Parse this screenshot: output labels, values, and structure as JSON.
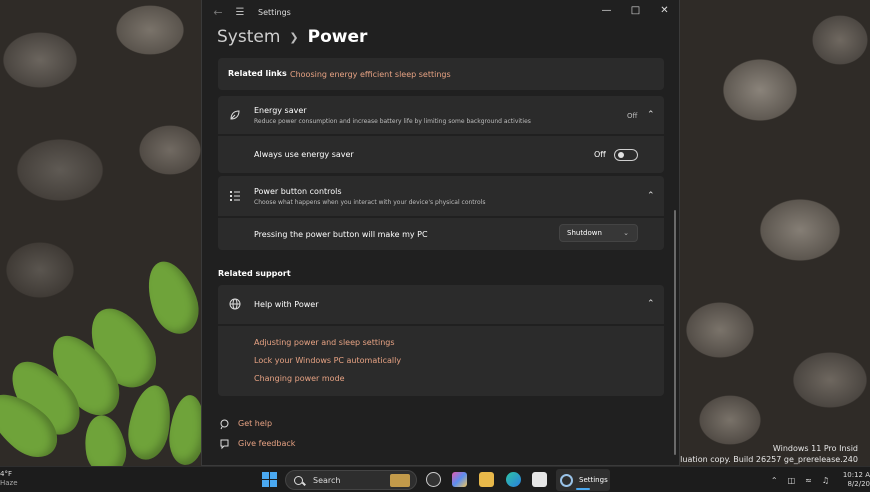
{
  "window": {
    "title": "Settings",
    "breadcrumb_parent": "System",
    "breadcrumb_current": "Power"
  },
  "related_links": {
    "label": "Related links",
    "link": "Choosing energy efficient sleep settings"
  },
  "energy_saver": {
    "title": "Energy saver",
    "subtitle": "Reduce power consumption and increase battery life by limiting some background activities",
    "status": "Off",
    "always_label": "Always use energy saver",
    "toggle_state": "Off"
  },
  "power_button": {
    "title": "Power button controls",
    "subtitle": "Choose what happens when you interact with your device's physical controls",
    "row_label": "Pressing the power button will make my PC",
    "selected": "Shutdown"
  },
  "related_support": {
    "heading": "Related support",
    "help_title": "Help with Power",
    "links": [
      "Adjusting power and sleep settings",
      "Lock your Windows PC automatically",
      "Changing power mode"
    ]
  },
  "footer": {
    "get_help": "Get help",
    "give_feedback": "Give feedback"
  },
  "desktop": {
    "watermark_line1": "Windows 11 Pro Insid",
    "watermark_line2": "Evaluation copy. Build 26257 ge_prerelease.240"
  },
  "taskbar": {
    "weather_temp": "4°F",
    "weather_cond": "Haze",
    "search_placeholder": "Search",
    "active_app": "Settings",
    "time": "10:12 A",
    "date": "8/2/20"
  },
  "colors": {
    "link": "#e6a283",
    "window_bg": "#202020",
    "card_bg": "#2b2b2b",
    "accent": "#4aa8f0"
  }
}
